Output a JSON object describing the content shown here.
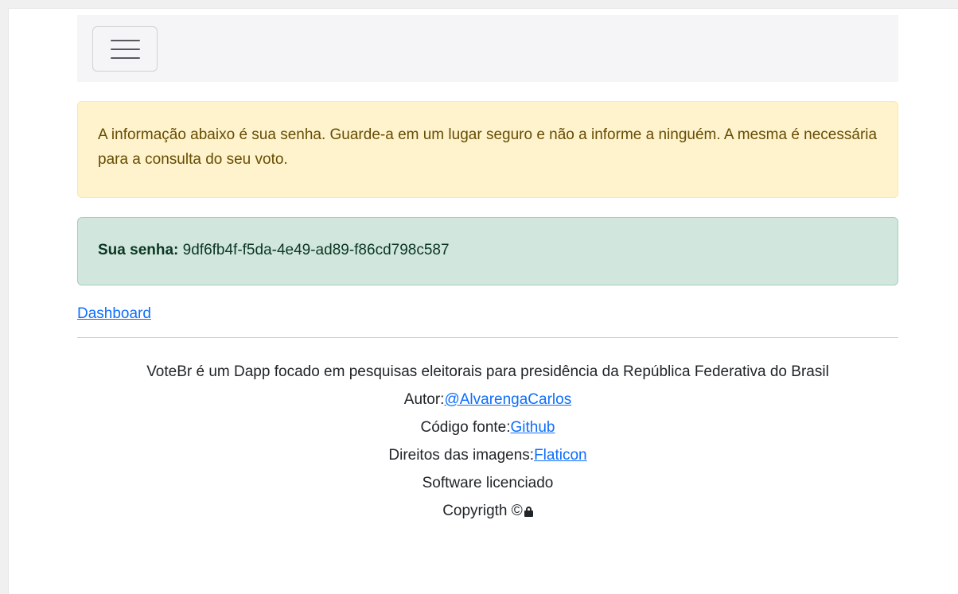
{
  "navbar": {
    "toggler_icon": "hamburger-menu-icon"
  },
  "alert_warning": {
    "text": "A informação abaixo é sua senha. Guarde-a em um lugar seguro e não a informe a ninguém. A mesma é necessária para a consulta do seu voto."
  },
  "alert_success": {
    "label": "Sua senha:",
    "value": "9df6fb4f-f5da-4e49-ad89-f86cd798c587"
  },
  "dashboard_link": {
    "label": "Dashboard"
  },
  "footer": {
    "description": "VoteBr é um Dapp focado em pesquisas eleitorais para presidência da República Federativa do Brasil",
    "author_label": "Autor:",
    "author_link": "@AlvarengaCarlos",
    "source_label": "Código fonte:",
    "source_link": "Github",
    "images_label": "Direitos das imagens:",
    "images_link": "Flaticon",
    "license": "Software licenciado",
    "copyright": "Copyrigth ©",
    "copyright_icon": "lock-icon"
  },
  "colors": {
    "warning_bg": "#fff3cd",
    "warning_text": "#664d03",
    "success_bg": "#d1e7dd",
    "success_text": "#0a3622",
    "link": "#0d6efd"
  }
}
